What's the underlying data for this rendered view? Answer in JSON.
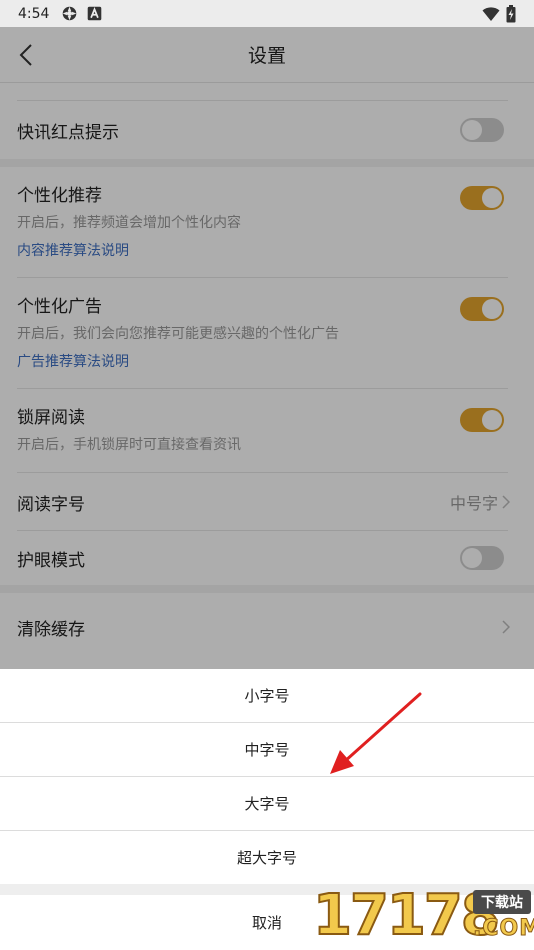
{
  "status_bar": {
    "time": "4:54"
  },
  "header": {
    "title": "设置"
  },
  "settings": {
    "news_red_dot": {
      "label": "快讯红点提示",
      "enabled": false
    },
    "personalized_recommend": {
      "label": "个性化推荐",
      "desc": "开启后，推荐频道会增加个性化内容",
      "link": "内容推荐算法说明",
      "enabled": true
    },
    "personalized_ads": {
      "label": "个性化广告",
      "desc": "开启后，我们会向您推荐可能更感兴趣的个性化广告",
      "link": "广告推荐算法说明",
      "enabled": true
    },
    "lockscreen_read": {
      "label": "锁屏阅读",
      "desc": "开启后，手机锁屏时可直接查看资讯",
      "enabled": true
    },
    "font_size": {
      "label": "阅读字号",
      "value": "中号字"
    },
    "eye_mode": {
      "label": "护眼模式",
      "enabled": false
    },
    "clear_cache": {
      "label": "清除缓存"
    }
  },
  "font_sheet": {
    "options": [
      "小字号",
      "中字号",
      "大字号",
      "超大字号"
    ],
    "cancel": "取消"
  },
  "watermark": {
    "digits": "17178",
    "badge": "下载站",
    "suffix": ".COM"
  },
  "colors": {
    "toggle_on": "#e3a42d",
    "link": "#3f6fc2",
    "arrow": "#e02020"
  }
}
